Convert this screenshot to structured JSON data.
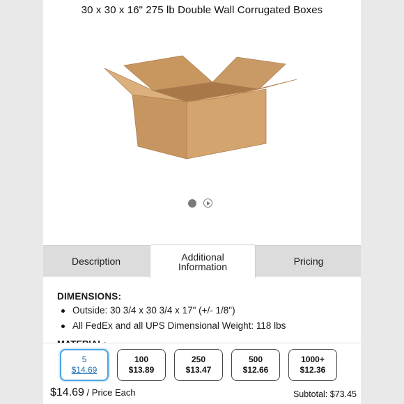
{
  "product": {
    "title": "30 x 30 x 16\" 275 lb Double Wall Corrugated Boxes",
    "image_icon": "cardboard-box-image"
  },
  "carousel": {
    "indicators": [
      "image-dot-icon",
      "video-play-icon"
    ]
  },
  "tabs": [
    {
      "label": "Description"
    },
    {
      "label": "Additional\nInformation",
      "active": true
    },
    {
      "label": "Pricing"
    }
  ],
  "info": {
    "dimensions_heading": "DIMENSIONS:",
    "bullets": [
      "Outside: 30 3/4 x 30 3/4 x 17\" (+/- 1/8\")",
      "All FedEx and all UPS Dimensional Weight: 118 lbs"
    ],
    "next_heading": "MATERIAL:"
  },
  "pricing": {
    "tiers": [
      {
        "qty": "5",
        "price": "$14.69",
        "selected": true
      },
      {
        "qty": "100",
        "price": "$13.89"
      },
      {
        "qty": "250",
        "price": "$13.47"
      },
      {
        "qty": "500",
        "price": "$12.66"
      },
      {
        "qty": "1000+",
        "price": "$12.36"
      }
    ],
    "unit_price": "$14.69",
    "unit_label": " / Price Each",
    "subtotal": "Subtotal: $73.45"
  },
  "colors": {
    "selected_tier_border": "#4aa3e0",
    "selected_tier_text": "#1e6fb5",
    "tab_bar": "#dcdcdc"
  }
}
